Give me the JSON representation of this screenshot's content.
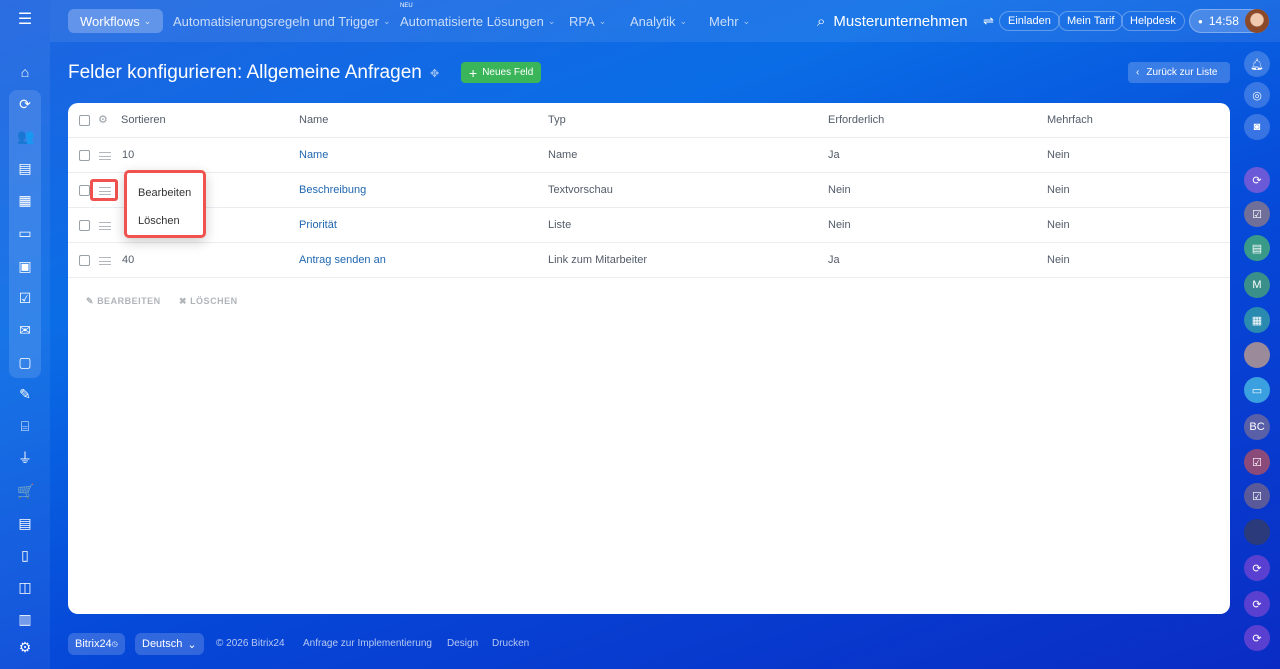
{
  "topnav": {
    "items": [
      {
        "label": "Workflows"
      },
      {
        "label": "Automatisierungsregeln und Trigger"
      },
      {
        "label": "Automatisierte Lösungen",
        "badge": "NEU"
      },
      {
        "label": "RPA"
      },
      {
        "label": "Analytik"
      },
      {
        "label": "Mehr"
      }
    ],
    "company": "Musterunternehmen",
    "invite": "Einladen",
    "plan": "Mein Tarif",
    "helpdesk": "Helpdesk",
    "time": "14:58"
  },
  "page": {
    "title": "Felder konfigurieren: Allgemeine Anfragen",
    "new_field": "Neues Feld",
    "back": "Zurück zur Liste"
  },
  "table": {
    "headers": {
      "sort": "Sortieren",
      "name": "Name",
      "type": "Typ",
      "required": "Erforderlich",
      "multiple": "Mehrfach"
    },
    "rows": [
      {
        "sort": "10",
        "name": "Name",
        "type": "Name",
        "required": "Ja",
        "multiple": "Nein"
      },
      {
        "sort": "",
        "name": "Beschreibung",
        "type": "Textvorschau",
        "required": "Nein",
        "multiple": "Nein"
      },
      {
        "sort": "",
        "name": "Priorität",
        "type": "Liste",
        "required": "Nein",
        "multiple": "Nein"
      },
      {
        "sort": "40",
        "name": "Antrag senden an",
        "type": "Link zum Mitarbeiter",
        "required": "Ja",
        "multiple": "Nein"
      }
    ],
    "actions": {
      "edit": "BEARBEITEN",
      "delete": "LÖSCHEN"
    }
  },
  "context_menu": {
    "edit": "Bearbeiten",
    "delete": "Löschen"
  },
  "right_sidebar": {
    "initials_m": "M",
    "initials_bc": "BC"
  },
  "footer": {
    "brand": "Bitrix24",
    "language": "Deutsch",
    "copyright": "© 2026 Bitrix24",
    "links": [
      "Anfrage zur Implementierung",
      "Design",
      "Drucken"
    ]
  },
  "colors": {
    "accent_green": "#3bb55a",
    "link": "#2067b0",
    "highlight": "#f0524f"
  }
}
